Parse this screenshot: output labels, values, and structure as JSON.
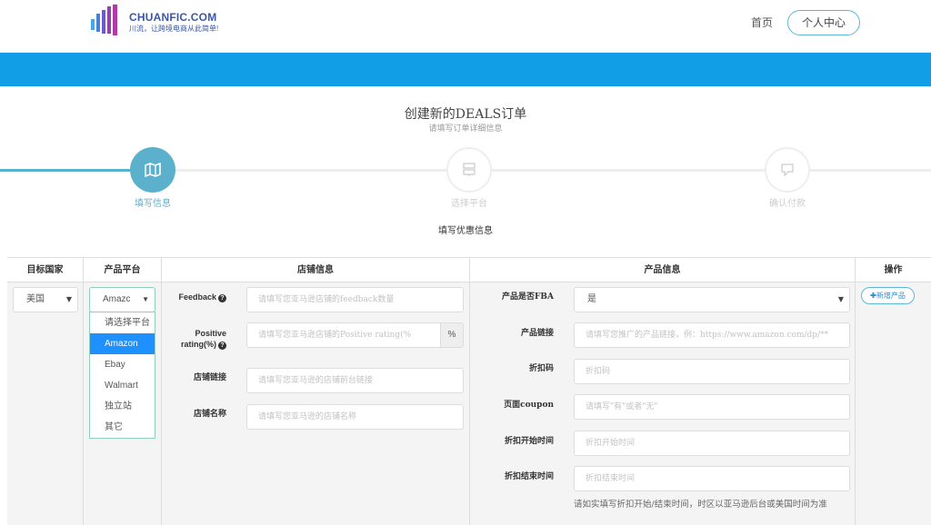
{
  "header": {
    "logo_text": "CHUANFIC.COM",
    "logo_sub": "川流，让跨境电商从此简单!",
    "nav_home": "首页",
    "nav_user_center": "个人中心"
  },
  "form": {
    "title": "创建新的DEALS订单",
    "subtitle": "请填写订单详细信息"
  },
  "steps": [
    {
      "label": "填写信息",
      "state": "active",
      "icon": "map-icon"
    },
    {
      "label": "选择平台",
      "state": "inactive",
      "icon": "server-icon"
    },
    {
      "label": "确认付款",
      "state": "inactive",
      "icon": "chat-icon"
    }
  ],
  "section_title": "填写优惠信息",
  "table": {
    "headers": {
      "country": "目标国家",
      "platform": "产品平台",
      "store": "店铺信息",
      "product": "产品信息",
      "actions": "操作"
    }
  },
  "country_select": {
    "value": "美国"
  },
  "platform_select": {
    "value": "Amazc",
    "options": [
      "请选择平台",
      "Amazon",
      "Ebay",
      "Walmart",
      "独立站",
      "其它"
    ],
    "selected_index": 1
  },
  "store": {
    "feedback_label": "Feedback",
    "feedback_placeholder": "请填写您亚马逊店铺的feedback数量",
    "rating_label_1": "Positive",
    "rating_label_2": "rating(%)",
    "rating_placeholder": "请填写您亚马逊店铺的Positive rating(%",
    "rating_addon": "%",
    "link_label": "店铺链接",
    "link_placeholder": "请填写您亚马逊的店铺前台链接",
    "name_label": "店铺名称",
    "name_placeholder": "请填写您亚马逊的店铺名称"
  },
  "product": {
    "fba_label": "产品是否FBA",
    "fba_value": "是",
    "link_label": "产品链接",
    "link_placeholder": "请填写您推广的产品链接，例：https://www.amazon.com/dp/**",
    "code_label": "折扣码",
    "code_placeholder": "折扣码",
    "coupon_label": "页面coupon",
    "coupon_placeholder": "请填写\"有\"或者\"无\"",
    "start_label": "折扣开始时间",
    "start_placeholder": "折扣开始时间",
    "end_label": "折扣结束时间",
    "end_placeholder": "折扣结束时间",
    "note": "请如实填写折扣开始/结束时间，时区以亚马逊后台或美国时间为准"
  },
  "actions": {
    "add_product": "新增产品"
  },
  "colors": {
    "banner": "#129ee6",
    "active_step": "#5bb0cc",
    "accent_border": "#5bb8d6",
    "dropdown_selected": "#1e90ff"
  }
}
